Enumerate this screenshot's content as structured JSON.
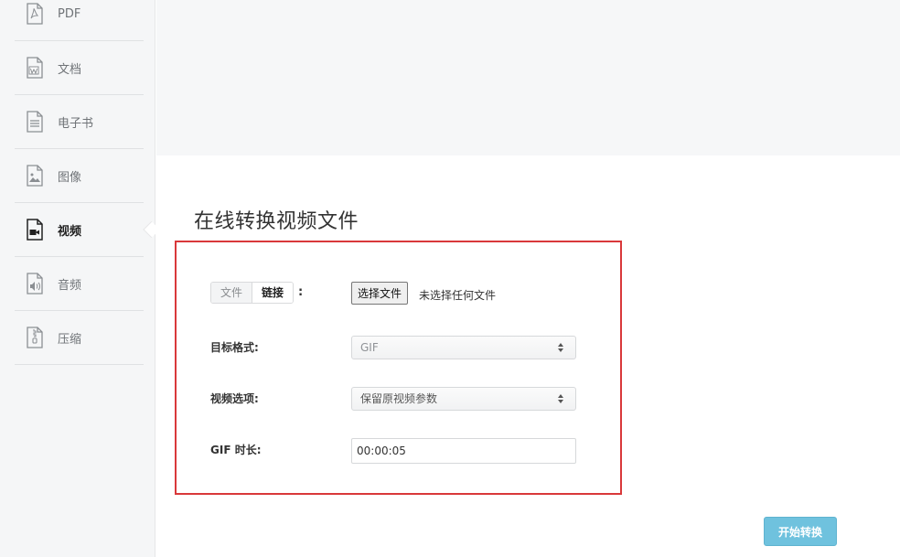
{
  "sidebar": {
    "items": [
      {
        "label": "PDF",
        "icon": "pdf-file-icon",
        "active": false
      },
      {
        "label": "文档",
        "icon": "word-document-icon",
        "active": false
      },
      {
        "label": "电子书",
        "icon": "ebook-icon",
        "active": false
      },
      {
        "label": "图像",
        "icon": "image-file-icon",
        "active": false
      },
      {
        "label": "视频",
        "icon": "video-file-icon",
        "active": true
      },
      {
        "label": "音频",
        "icon": "audio-file-icon",
        "active": false
      },
      {
        "label": "压缩",
        "icon": "archive-file-icon",
        "active": false
      }
    ]
  },
  "page": {
    "title": "在线转换视频文件"
  },
  "form": {
    "source_tabs": {
      "file": "文件",
      "link": "链接",
      "colon": ":"
    },
    "file_picker": {
      "button": "选择文件",
      "status": "未选择任何文件"
    },
    "target_format": {
      "label": "目标格式:",
      "value": "GIF"
    },
    "video_options": {
      "label": "视频选项:",
      "value": "保留原视频参数"
    },
    "gif_duration": {
      "label": "GIF 时长:",
      "value": "00:00:05"
    }
  },
  "actions": {
    "start": "开始转换"
  },
  "colors": {
    "highlight_border": "#d9383a",
    "start_button": "#6fc2de",
    "sidebar_bg": "#f5f6f7"
  }
}
